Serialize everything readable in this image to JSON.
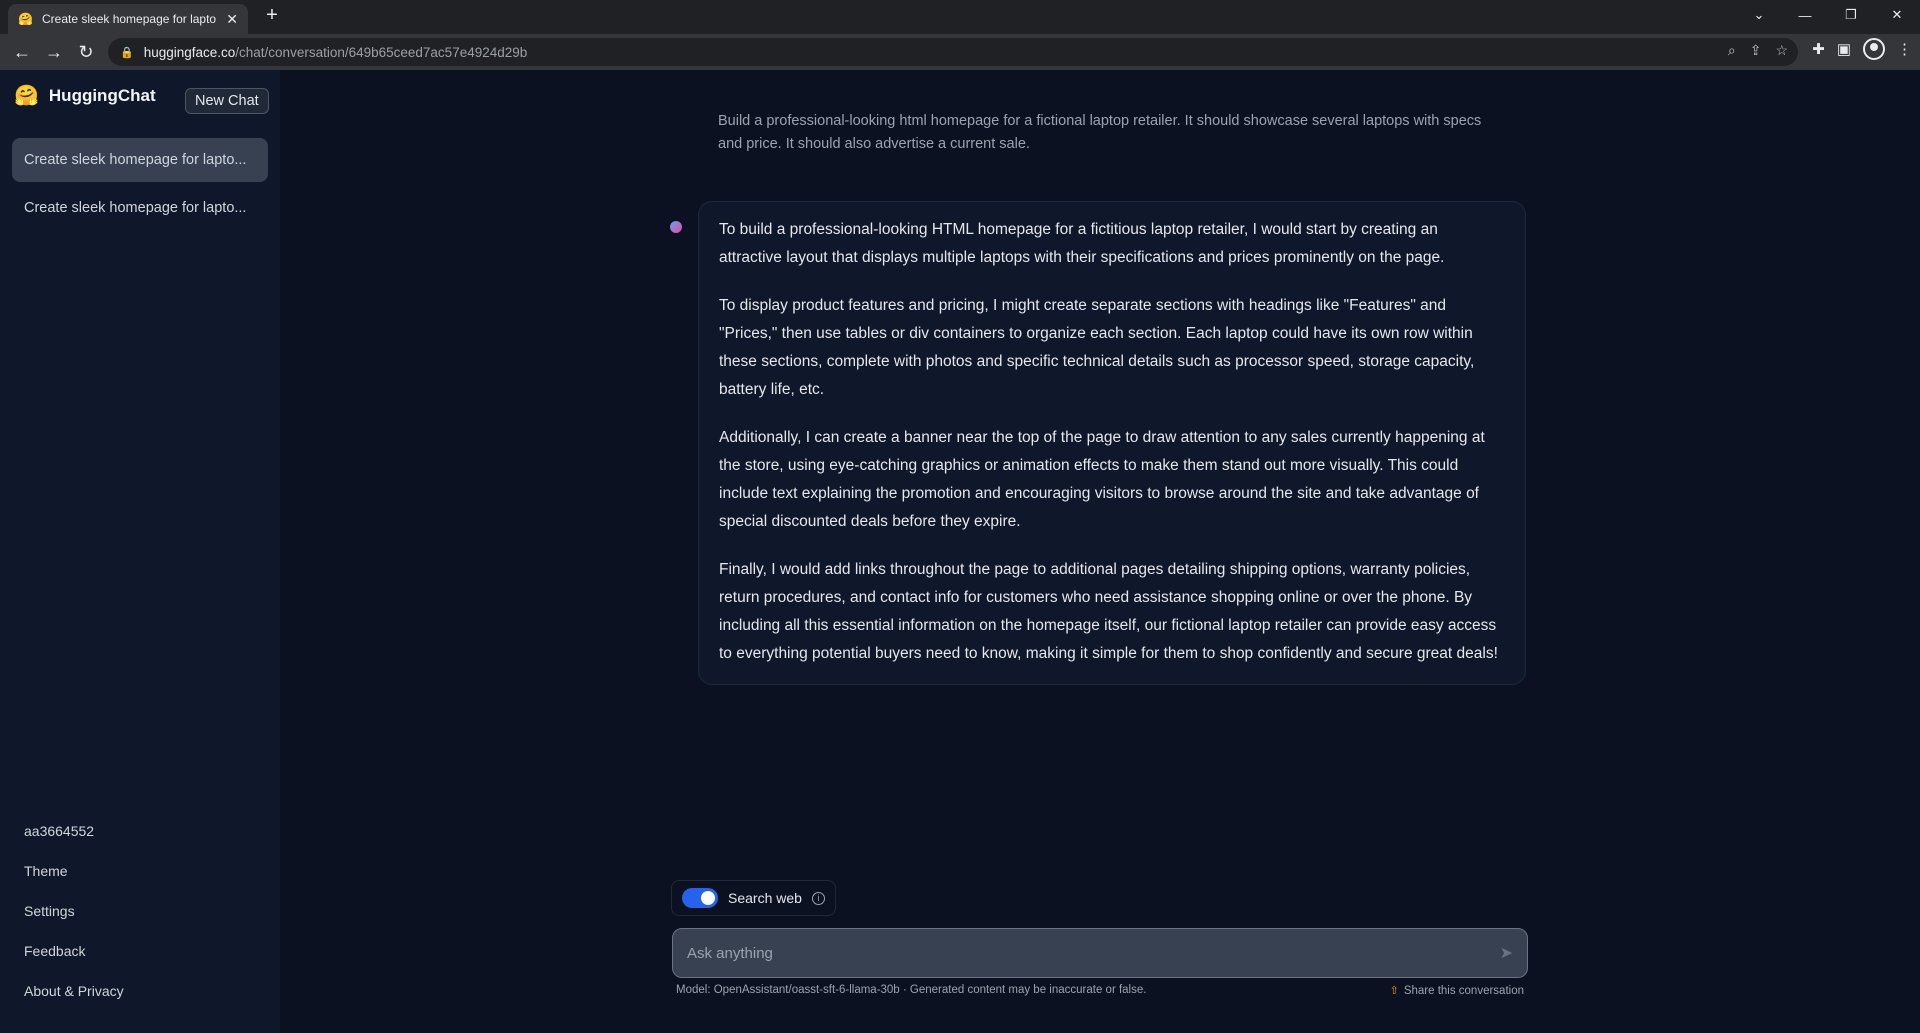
{
  "browser": {
    "tab_title": "Create sleek homepage for lapto",
    "tab_favicon": "🤗",
    "url_host": "huggingface.co",
    "url_path": "/chat/conversation/649b65ceed7ac57e4924d29b"
  },
  "sidebar": {
    "brand": "HuggingChat",
    "logo": "🤗",
    "new_chat": "New Chat",
    "conversations": [
      {
        "label": "Create sleek homepage for lapto..."
      },
      {
        "label": "Create sleek homepage for lapto..."
      }
    ],
    "bottom": {
      "user": "aa3664552",
      "theme": "Theme",
      "settings": "Settings",
      "feedback": "Feedback",
      "about": "About & Privacy"
    }
  },
  "chat": {
    "user_message": "Build a professional-looking html homepage for a fictional laptop retailer. It should showcase several laptops with specs and price. It should also advertise a current sale.",
    "assistant_paragraphs": [
      "To build a professional-looking HTML homepage for a fictitious laptop retailer, I would start by creating an attractive layout that displays multiple laptops with their specifications and prices prominently on the page.",
      "To display product features and pricing, I might create separate sections with headings like \"Features\" and \"Prices,\" then use tables or div containers to organize each section. Each laptop could have its own row within these sections, complete with photos and specific technical details such as processor speed, storage capacity, battery life, etc.",
      "Additionally, I can create a banner near the top of the page to draw attention to any sales currently happening at the store, using eye-catching graphics or animation effects to make them stand out more visually. This could include text explaining the promotion and encouraging visitors to browse around the site and take advantage of special discounted deals before they expire.",
      "Finally, I would add links throughout the page to additional pages detailing shipping options, warranty policies, return procedures, and contact info for customers who need assistance shopping online or over the phone. By including all this essential information on the homepage itself, our fictional laptop retailer can provide easy access to everything potential buyers need to know, making it simple for them to shop confidently and secure great deals!"
    ]
  },
  "composer": {
    "search_web_label": "Search web",
    "search_web_enabled": true,
    "placeholder": "Ask anything",
    "model_note": "Model: OpenAssistant/oasst-sft-6-llama-30b · Generated content may be inaccurate or false.",
    "share_label": "Share this conversation"
  },
  "colors": {
    "background": "#0b1120",
    "sidebar": "#0f172a",
    "accent": "#2563eb"
  }
}
